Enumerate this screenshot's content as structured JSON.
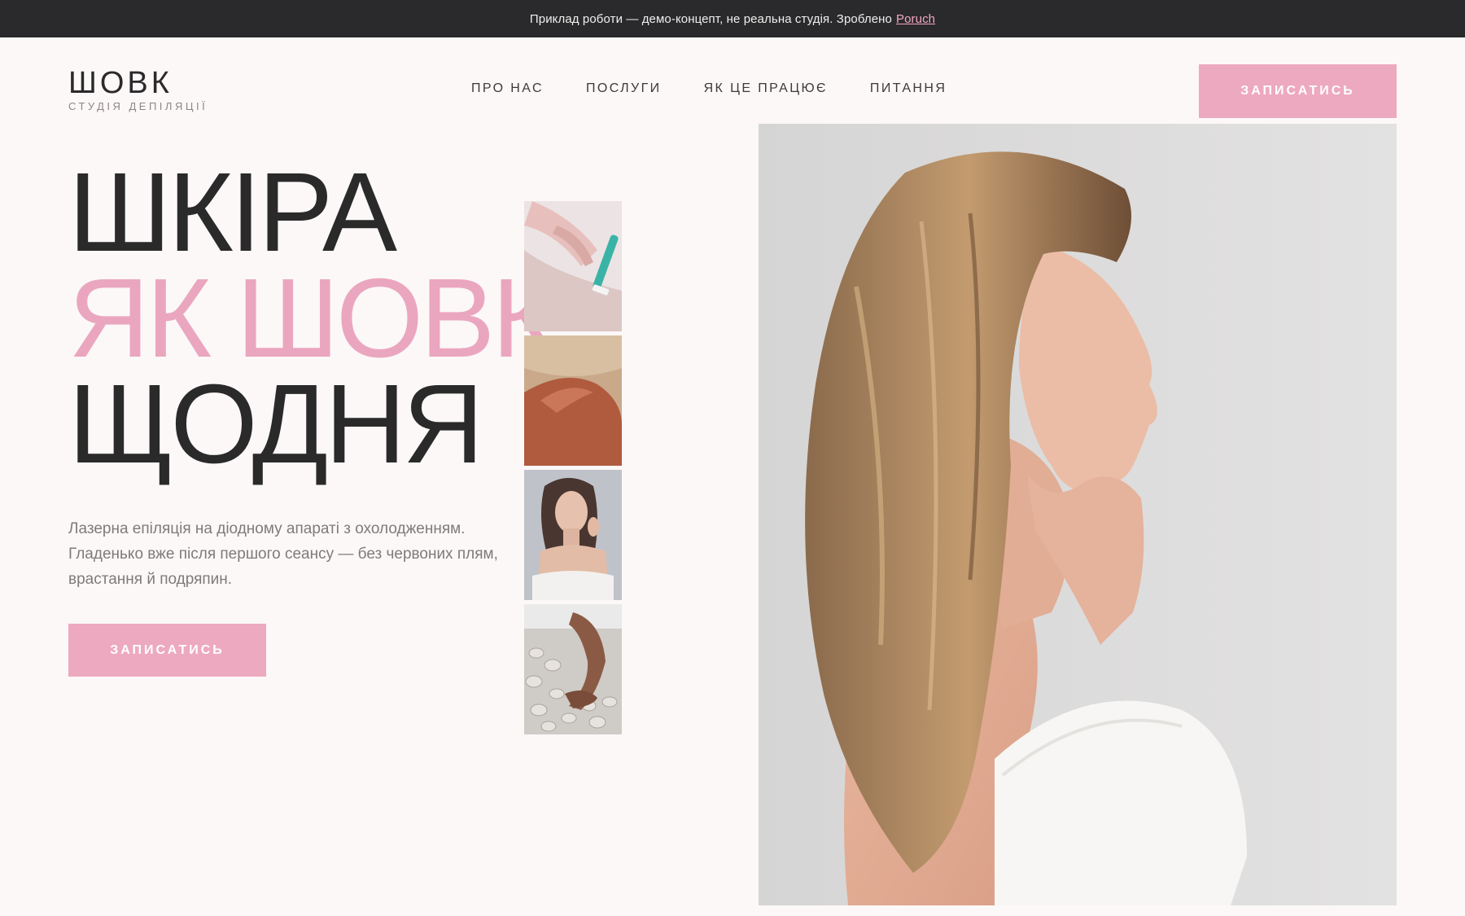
{
  "banner": {
    "text": "Приклад роботи — демо-концепт, не реальна студія. Зроблено",
    "link": "Poruch"
  },
  "logo": {
    "name": "ШОВК",
    "subtitle": "СТУДІЯ ДЕПІЛЯЦІЇ"
  },
  "nav": {
    "items": [
      "ПРО НАС",
      "ПОСЛУГИ",
      "ЯК ЦЕ ПРАЦЮЄ",
      "ПИТАННЯ"
    ]
  },
  "header": {
    "cta_label": "ЗАПИСАТИСЬ"
  },
  "hero": {
    "line1": "ШКІРА",
    "line2": "ЯК ШОВК",
    "line3": "ЩОДНЯ",
    "lead": "Лазерна епіляція на діодному апараті з охолодженням. Гладенько вже після першого сеансу — без червоних плям, врастання й подряпин.",
    "cta_label": "ЗАПИСАТИСЬ"
  },
  "colors": {
    "accent": "#eda9c0",
    "dark": "#2b2a2b",
    "background": "#fcf8f8",
    "banner_bg": "#2a2a2c"
  }
}
